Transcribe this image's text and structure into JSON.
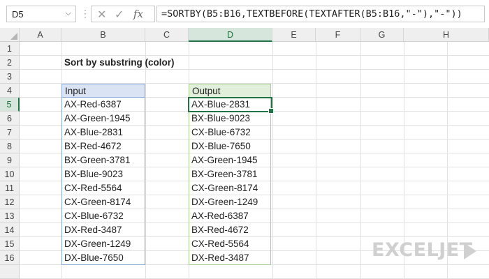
{
  "formula_bar": {
    "name_box": "D5",
    "dropdown_icon": "chevron-down-icon",
    "more_icon": "vertical-dots-icon",
    "cancel_icon": "x-icon",
    "enter_icon": "check-icon",
    "fx_label": "fx",
    "formula": "=SORTBY(B5:B16,TEXTBEFORE(TEXTAFTER(B5:B16,\"-\"),\"-\"))"
  },
  "columns": [
    "A",
    "B",
    "C",
    "D",
    "E",
    "F",
    "G",
    "H"
  ],
  "selected_column": "D",
  "rows": [
    "1",
    "2",
    "3",
    "4",
    "5",
    "6",
    "7",
    "8",
    "9",
    "10",
    "11",
    "12",
    "13",
    "14",
    "15",
    "16"
  ],
  "selected_row": "5",
  "sheet": {
    "title": "Sort by substring (color)",
    "input_header": "Input",
    "output_header": "Output",
    "input": [
      "AX-Red-6387",
      "AX-Green-1945",
      "AX-Blue-2831",
      "BX-Red-4672",
      "BX-Green-3781",
      "BX-Blue-9023",
      "CX-Red-5564",
      "CX-Green-8174",
      "CX-Blue-6732",
      "DX-Red-3487",
      "DX-Green-1249",
      "DX-Blue-7650"
    ],
    "output": [
      "AX-Blue-2831",
      "BX-Blue-9023",
      "CX-Blue-6732",
      "DX-Blue-7650",
      "AX-Green-1945",
      "BX-Green-3781",
      "CX-Green-8174",
      "DX-Green-1249",
      "AX-Red-6387",
      "BX-Red-4672",
      "CX-Red-5564",
      "DX-Red-3487"
    ]
  },
  "colors": {
    "accent": "#217346",
    "input_header_fill": "#dae3f3",
    "output_header_fill": "#e2efda"
  },
  "watermark": "EXCELJET"
}
